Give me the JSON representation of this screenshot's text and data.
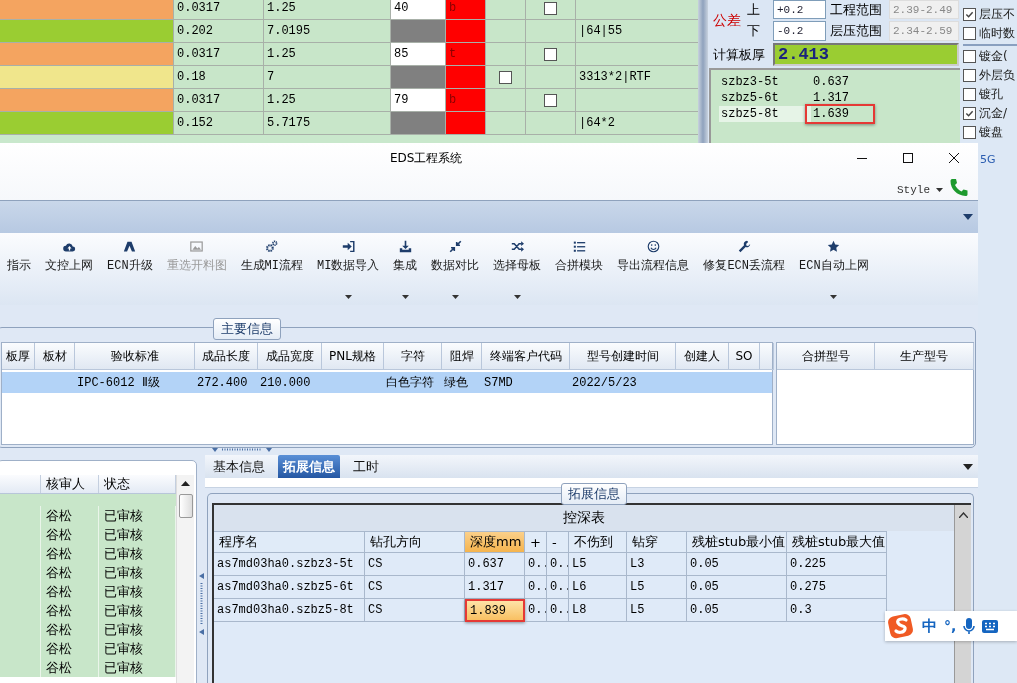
{
  "sheet": {
    "rows": [
      {
        "color": "#f4a460",
        "column_2": "0.0317",
        "column_3": "1.25",
        "column_4": {
          "kind": "input",
          "text": "40"
        },
        "column_5": "b",
        "checkbox_7": false
      },
      {
        "color": "#9acd32",
        "column_2": "0.202",
        "column_3": "7.0195",
        "column_4": {
          "kind": "blank"
        },
        "column_8": "|64|55"
      },
      {
        "color": "#f4a460",
        "column_2": "0.0317",
        "column_3": "1.25",
        "column_4": {
          "kind": "input",
          "text": "85"
        },
        "column_5": "t",
        "checkbox_7": false
      },
      {
        "color": "#f0e68c",
        "column_2": "0.18",
        "column_3": "7",
        "column_4": {
          "kind": "blank"
        },
        "checkbox_6": false,
        "column_8": "3313*2|RTF"
      },
      {
        "color": "#f4a460",
        "column_2": "0.0317",
        "column_3": "1.25",
        "column_4": {
          "kind": "input",
          "text": "79"
        },
        "column_5": "b",
        "checkbox_7": false
      },
      {
        "color": "#9acd32",
        "column_2": "0.152",
        "column_3": "5.7175",
        "column_4": {
          "kind": "blank"
        },
        "column_8": "|64*2"
      }
    ]
  },
  "tolerance": {
    "label": "公差",
    "upper_label": "上",
    "upper": "+0.2",
    "lower_label": "下",
    "lower": "-0.2",
    "eng_range_label": "工程范围",
    "eng_range": "2.39-2.49",
    "lam_range_label": "层压范围",
    "lam_range": "2.34-2.59",
    "calc_label": "计算板厚",
    "calc": "2.413",
    "depths": [
      {
        "name": "szbz3-5t",
        "value": "0.637",
        "highlighted": false
      },
      {
        "name": "szbz5-6t",
        "value": "1.317",
        "highlighted": false
      },
      {
        "name": "szbz5-8t",
        "value": "1.639",
        "highlighted": true
      }
    ]
  },
  "option_groups": [
    [
      {
        "label": "层压不",
        "checked": true
      },
      {
        "label": "临时数",
        "checked": false
      }
    ],
    [
      {
        "label": "镀金(",
        "checked": false
      },
      {
        "label": "外层负",
        "checked": false
      },
      {
        "label": "镀孔",
        "checked": false
      },
      {
        "label": "沉金/",
        "checked": true
      },
      {
        "label": "镀盘",
        "checked": false
      }
    ]
  ],
  "side_strip": {
    "text": "5G"
  },
  "window": {
    "title": "EDS工程系统",
    "style_menu": "Style",
    "ribbon": [
      {
        "label": "指示",
        "disabled": false,
        "menu": false
      },
      {
        "label": "文控上网",
        "disabled": false,
        "menu": false
      },
      {
        "label": "ECN升级",
        "disabled": false,
        "menu": false
      },
      {
        "label": "重选开料图",
        "disabled": true,
        "menu": false
      },
      {
        "label": "生成MI流程",
        "disabled": false,
        "menu": false
      },
      {
        "label": "MI数据导入",
        "disabled": false,
        "menu": true
      },
      {
        "label": "集成",
        "disabled": false,
        "menu": true
      },
      {
        "label": "数据对比",
        "disabled": false,
        "menu": true
      },
      {
        "label": "选择母板",
        "disabled": false,
        "menu": true
      },
      {
        "label": "合拼模块",
        "disabled": false,
        "menu": false
      },
      {
        "label": "导出流程信息",
        "disabled": false,
        "menu": false
      },
      {
        "label": "修复ECN丢流程",
        "disabled": false,
        "menu": false
      },
      {
        "label": "ECN自动上网",
        "disabled": false,
        "menu": true
      }
    ],
    "main_info": {
      "legend": "主要信息",
      "columns": [
        "板厚",
        "板材",
        "验收标准",
        "成品长度",
        "成品宽度",
        "PNL规格",
        "字符",
        "阻焊",
        "终端客户代码",
        "型号创建时间",
        "创建人",
        "SO"
      ],
      "rows": [
        {
          "selected": true,
          "cells": {
            "2": "IPC-6012 Ⅱ级",
            "3": "272.400",
            "4": "210.000",
            "6": "白色字符",
            "7": "绿色",
            "8": "S7MD",
            "9": "2022/5/23"
          }
        }
      ],
      "side_columns": [
        "合拼型号",
        "生产型号"
      ]
    },
    "reviews": {
      "columns": [
        "核审人",
        "状态"
      ],
      "rows": [
        {
          "reviewer": "谷松",
          "status": "已审核"
        },
        {
          "reviewer": "谷松",
          "status": "已审核"
        },
        {
          "reviewer": "谷松",
          "status": "已审核"
        },
        {
          "reviewer": "谷松",
          "status": "已审核"
        },
        {
          "reviewer": "谷松",
          "status": "已审核"
        },
        {
          "reviewer": "谷松",
          "status": "已审核"
        },
        {
          "reviewer": "谷松",
          "status": "已审核"
        },
        {
          "reviewer": "谷松",
          "status": "已审核"
        },
        {
          "reviewer": "谷松",
          "status": "已审核"
        }
      ]
    },
    "tabs": [
      {
        "label": "基本信息",
        "selected": false
      },
      {
        "label": "拓展信息",
        "selected": true
      },
      {
        "label": "工时",
        "selected": false
      }
    ],
    "ext": {
      "legend": "拓展信息",
      "title": "控深表",
      "columns": [
        {
          "label": "程序名",
          "selected": false
        },
        {
          "label": "钻孔方向",
          "selected": false
        },
        {
          "label": "深度mm",
          "selected": true
        },
        {
          "label": "+",
          "selected": false
        },
        {
          "label": "-",
          "selected": false
        },
        {
          "label": "不伤到",
          "selected": false
        },
        {
          "label": "钻穿",
          "selected": false
        },
        {
          "label": "残桩stub最小值",
          "selected": false
        },
        {
          "label": "残桩stub最大值",
          "selected": false
        }
      ],
      "rows": [
        {
          "cells": [
            "as7md03ha0.szbz3-5t",
            "CS",
            "0.637",
            "0..",
            "0..",
            "L5",
            "L3",
            "0.05",
            "0.225"
          ],
          "highlighted": false
        },
        {
          "cells": [
            "as7md03ha0.szbz5-6t",
            "CS",
            "1.317",
            "0..",
            "0..",
            "L6",
            "L5",
            "0.05",
            "0.275"
          ],
          "highlighted": false
        },
        {
          "cells": [
            "as7md03ha0.szbz5-8t",
            "CS",
            "1.839",
            "0..",
            "0..",
            "L8",
            "L5",
            "0.05",
            "0.3"
          ],
          "highlighted": true
        }
      ]
    }
  },
  "ime": {
    "mode": "中",
    "punctuation": "°,"
  }
}
